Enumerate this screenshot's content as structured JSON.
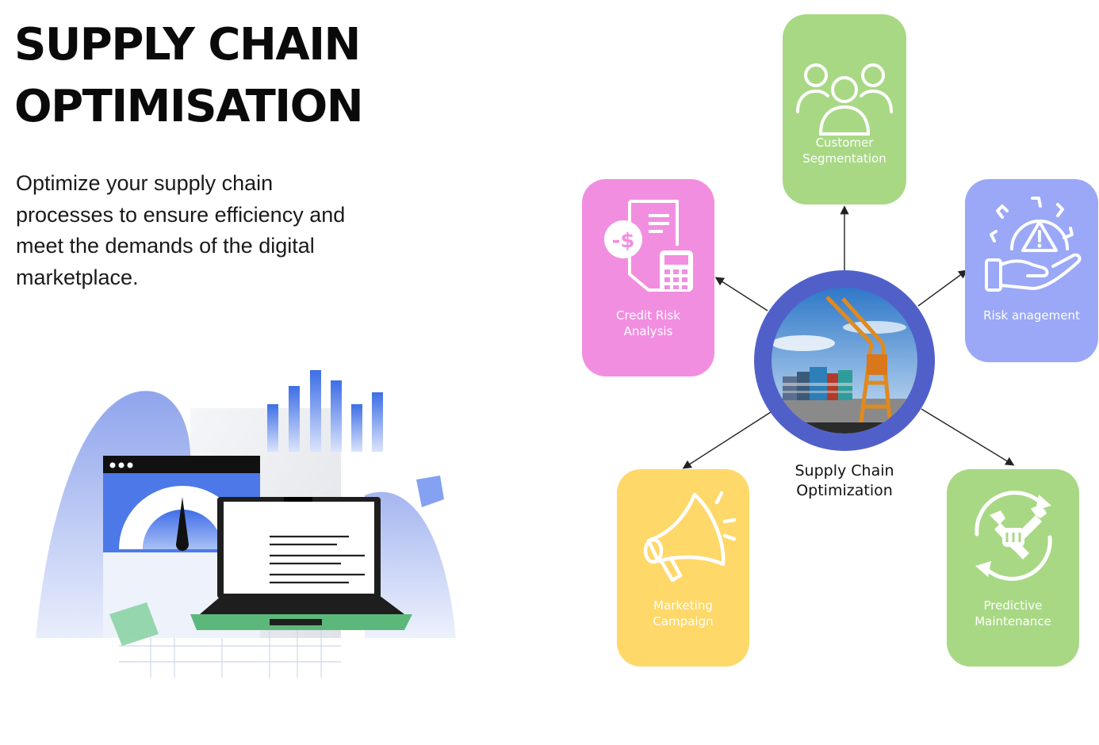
{
  "header": {
    "title_line1": "SUPPLY CHAIN",
    "title_line2": "OPTIMISATION",
    "description": "Optimize your supply chain processes to ensure efficiency and meet the demands of the digital marketplace."
  },
  "diagram": {
    "hub": {
      "line1": "Supply Chain",
      "line2": "Optimization",
      "ring_color": "#5160c9"
    },
    "nodes": [
      {
        "id": "customer",
        "line1": "Customer",
        "line2": "Segmentation",
        "icon": "people-group-icon",
        "color": "#a8d884"
      },
      {
        "id": "credit",
        "line1": "Credit Risk",
        "line2": "Analysis",
        "icon": "invoice-calculator-icon",
        "color": "#f28ee0"
      },
      {
        "id": "risk",
        "line1": "Risk anagement",
        "line2": "",
        "icon": "gear-warning-hand-icon",
        "color": "#9aa8f7"
      },
      {
        "id": "marketing",
        "line1": "Marketing",
        "line2": "Campaign",
        "icon": "megaphone-icon",
        "color": "#ffd86a"
      },
      {
        "id": "predictive",
        "line1": "Predictive",
        "line2": "Maintenance",
        "icon": "wrench-cycle-icon",
        "color": "#a8d884"
      }
    ]
  }
}
